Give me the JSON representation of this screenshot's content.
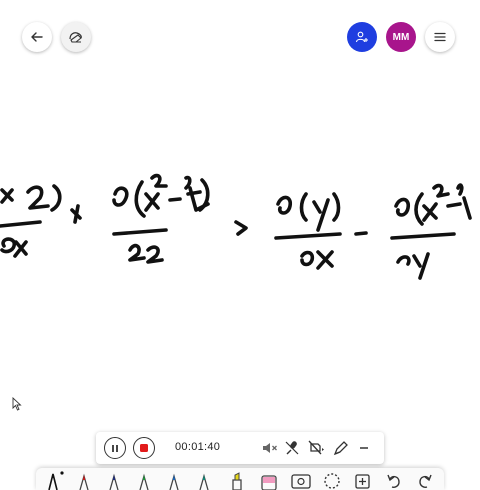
{
  "header": {
    "back_icon": "arrow-left-icon",
    "eraser_icon": "eraser-icon",
    "share_icon": "person-plus-icon",
    "user_initials": "MM",
    "menu_icon": "hamburger-menu-icon",
    "colors": {
      "share": "#1f3ee0",
      "user": "#a8158c"
    }
  },
  "recording": {
    "timer": "00:01:40",
    "pause_icon": "pause-icon",
    "stop_icon": "stop-icon",
    "mute_icon": "speaker-muted-icon",
    "mic_icon": "mic-off-icon",
    "camera_icon": "camera-off-icon",
    "pen_settings_icon": "pen-settings-icon",
    "minimize_icon": "minus-icon",
    "stop_color": "#e21b1b"
  },
  "tools": [
    {
      "name": "pen-black",
      "color": "#111111"
    },
    {
      "name": "pen-red",
      "color": "#d01818"
    },
    {
      "name": "pen-navy",
      "color": "#1a2a80"
    },
    {
      "name": "pen-green",
      "color": "#1a9a3a"
    },
    {
      "name": "pen-blue",
      "color": "#1565c0"
    },
    {
      "name": "pen-teal",
      "color": "#0a8c7a"
    },
    {
      "name": "highlighter-yellow",
      "color": "#e6d71a"
    },
    {
      "name": "eraser",
      "color": "#f19bc0"
    },
    {
      "name": "image",
      "color": "#333333"
    },
    {
      "name": "lasso-select",
      "color": "#333333"
    },
    {
      "name": "add-page",
      "color": "#333333"
    },
    {
      "name": "undo",
      "color": "#333333"
    },
    {
      "name": "redo",
      "color": "#333333"
    }
  ]
}
